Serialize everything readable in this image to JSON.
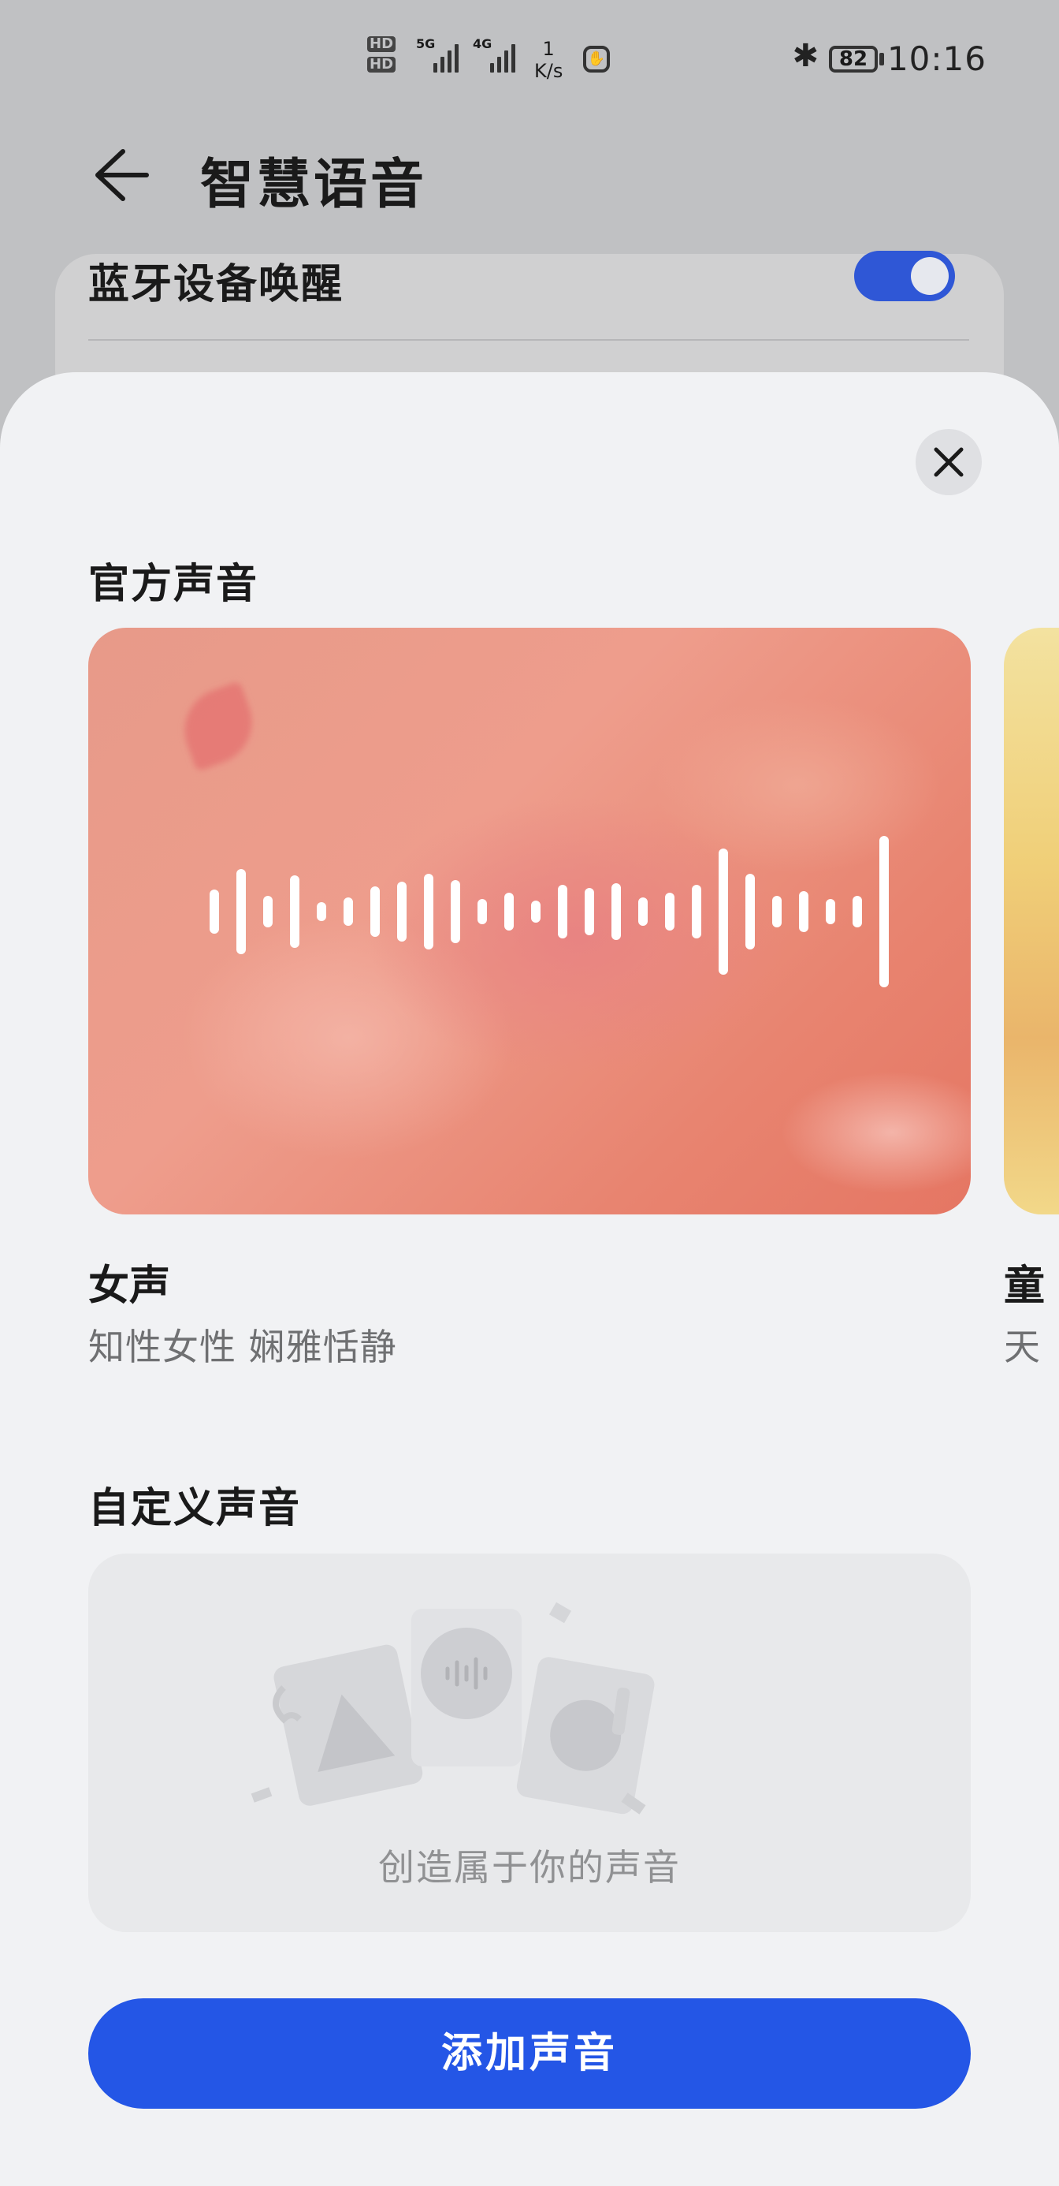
{
  "status_bar": {
    "time": "10:16",
    "battery": "82",
    "net_speed_value": "1",
    "net_speed_unit": "K/s",
    "sim1_label": "HD",
    "sim2_label": "HD",
    "net1": "5G",
    "net2": "4G",
    "icons": [
      "bluetooth-icon",
      "battery-icon",
      "signal-icon",
      "hand-icon"
    ]
  },
  "header": {
    "title": "智慧语音"
  },
  "background_setting": {
    "label": "蓝牙设备唤醒",
    "toggle_on": true,
    "accent": "#2f57d6"
  },
  "sheet": {
    "official_title": "官方声音",
    "voices": [
      {
        "name": "女声",
        "description": "知性女性 娴雅恬静"
      },
      {
        "name": "童",
        "description": "天"
      }
    ],
    "custom_title": "自定义声音",
    "custom_hint": "创造属于你的声音",
    "add_button": "添加声音",
    "button_color": "#2456e6"
  }
}
